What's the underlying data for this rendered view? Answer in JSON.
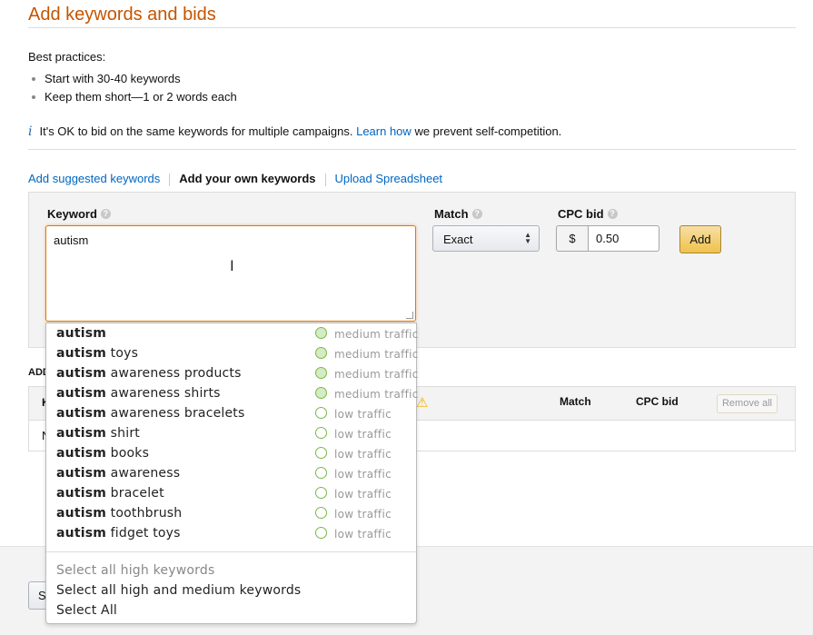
{
  "page": {
    "title": "Add keywords and bids"
  },
  "best_practices": {
    "heading": "Best practices:",
    "items": [
      "Start with 30-40 keywords",
      "Keep them short—1 or 2 words each"
    ]
  },
  "info": {
    "icon": "info-icon",
    "text_before": "It's OK to bid on the same keywords for multiple campaigns.",
    "link": "Learn how",
    "text_after": "we prevent self-competition."
  },
  "tabs": [
    {
      "label": "Add suggested keywords",
      "active": false
    },
    {
      "label": "Add your own keywords",
      "active": true
    },
    {
      "label": "Upload Spreadsheet",
      "active": false
    }
  ],
  "entry": {
    "keyword_label": "Keyword",
    "keyword_value": "autism",
    "match_label": "Match",
    "match_value": "Exact",
    "cpc_label": "CPC bid",
    "currency": "$",
    "cpc_value": "0.50",
    "add_label": "Add"
  },
  "added": {
    "heading": "ADD",
    "col_keyword": "K",
    "col_match": "Match",
    "col_cpc": "CPC bid",
    "remove_all": "Remove all",
    "empty_text": "N"
  },
  "footer": {
    "button_label": "S"
  },
  "suggestions": {
    "items": [
      {
        "bold": "autism",
        "rest": "",
        "traffic": "medium traffic",
        "level": "medium"
      },
      {
        "bold": "autism",
        "rest": " toys",
        "traffic": "medium traffic",
        "level": "medium"
      },
      {
        "bold": "autism",
        "rest": " awareness products",
        "traffic": "medium traffic",
        "level": "medium"
      },
      {
        "bold": "autism",
        "rest": " awareness shirts",
        "traffic": "medium traffic",
        "level": "medium"
      },
      {
        "bold": "autism",
        "rest": " awareness bracelets",
        "traffic": "low traffic",
        "level": "low"
      },
      {
        "bold": "autism",
        "rest": " shirt",
        "traffic": "low traffic",
        "level": "low"
      },
      {
        "bold": "autism",
        "rest": " books",
        "traffic": "low traffic",
        "level": "low"
      },
      {
        "bold": "autism",
        "rest": " awareness",
        "traffic": "low traffic",
        "level": "low"
      },
      {
        "bold": "autism",
        "rest": " bracelet",
        "traffic": "low traffic",
        "level": "low"
      },
      {
        "bold": "autism",
        "rest": " toothbrush",
        "traffic": "low traffic",
        "level": "low"
      },
      {
        "bold": "autism",
        "rest": " fidget toys",
        "traffic": "low traffic",
        "level": "low"
      }
    ],
    "actions": [
      {
        "label": "Select all high keywords",
        "enabled": false
      },
      {
        "label": "Select all high and medium keywords",
        "enabled": true
      },
      {
        "label": "Select All",
        "enabled": true
      }
    ]
  },
  "colors": {
    "title": "#c45500",
    "link": "#0066c0",
    "focus_border": "#e77600",
    "add_button": "#f0c14b",
    "traffic_ring": "#7ab648"
  }
}
